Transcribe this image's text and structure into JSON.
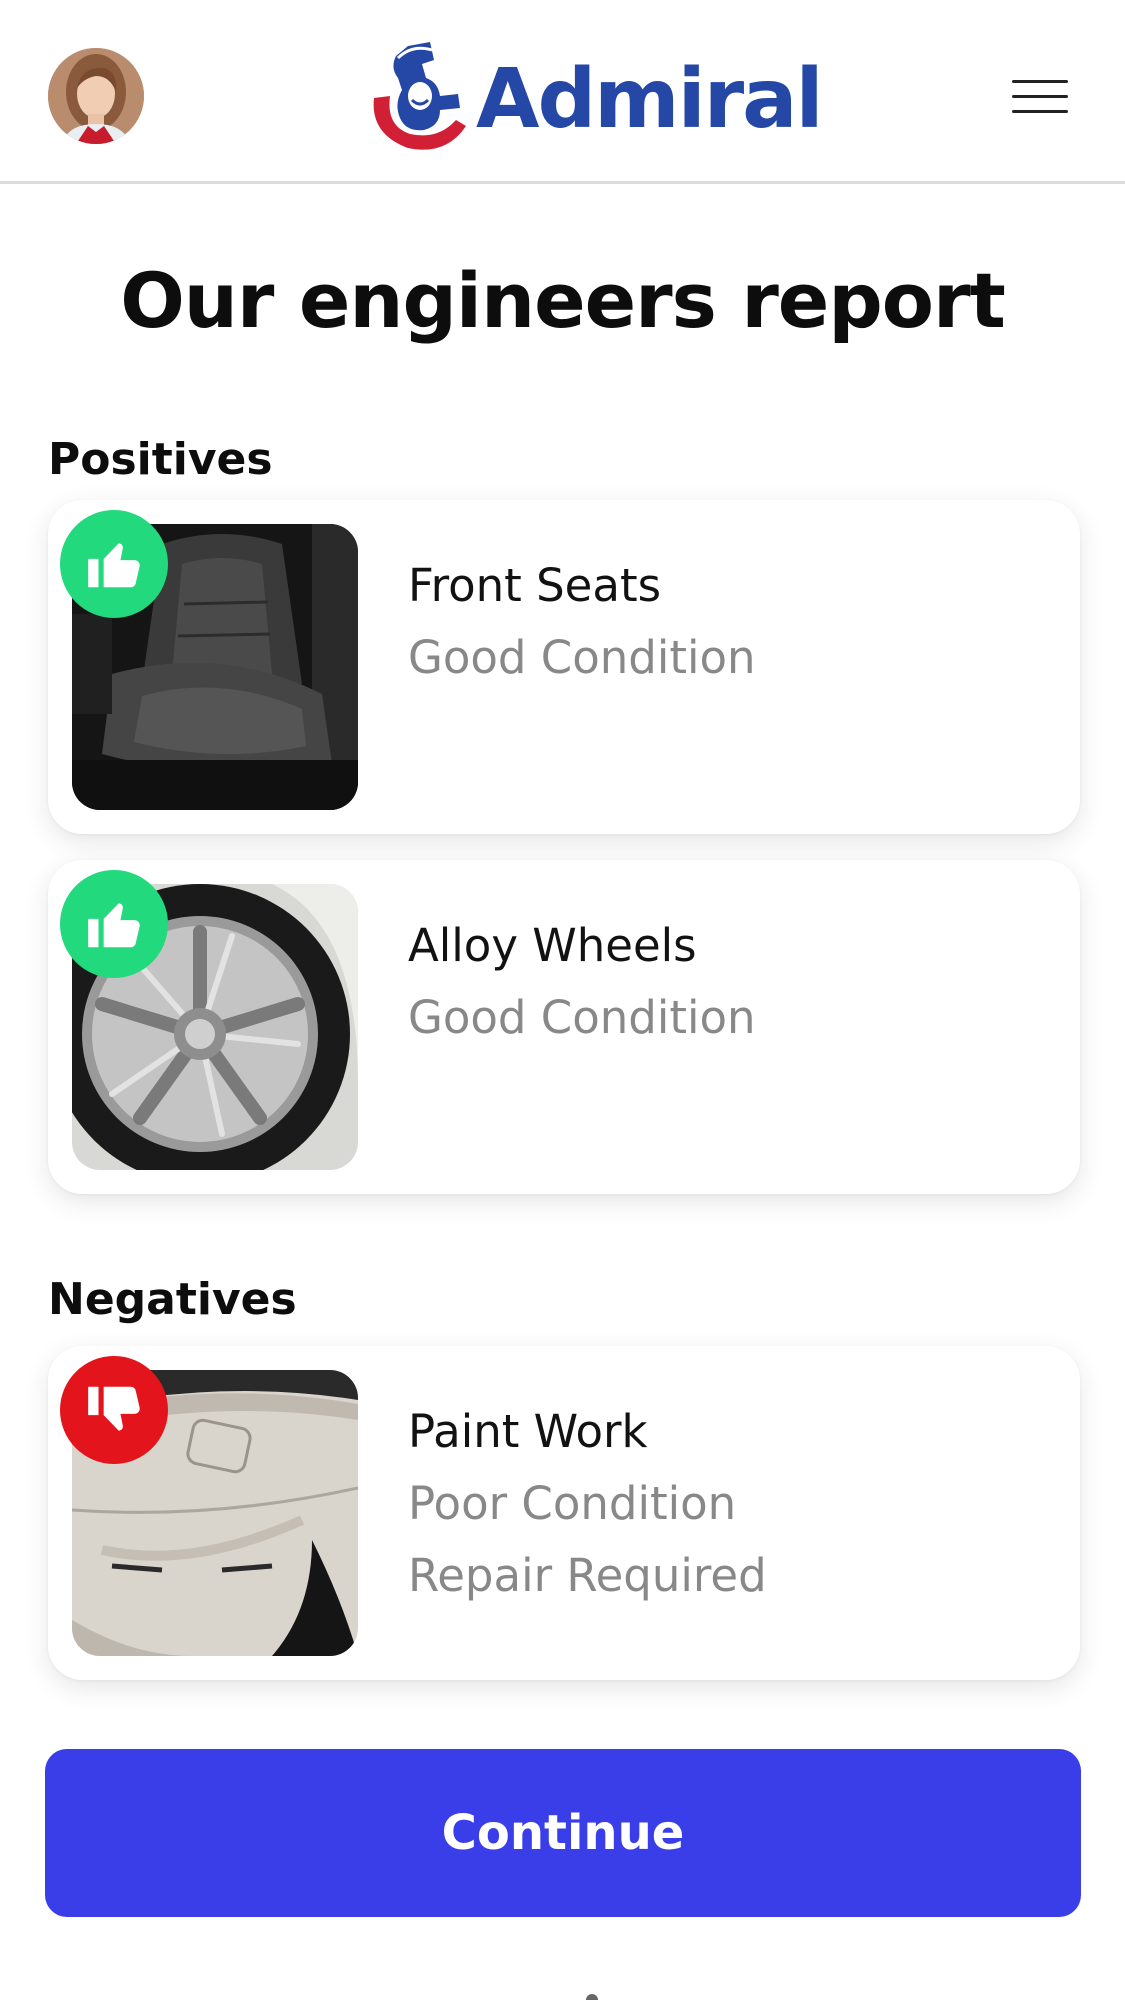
{
  "header": {
    "logo_text": "Admiral",
    "avatar_icon": "user-avatar",
    "menu_icon": "hamburger-menu-icon",
    "brand_color": "#2547a6"
  },
  "page_title": "Our engineers report",
  "positives": {
    "label": "Positives",
    "items": [
      {
        "title": "Front Seats",
        "status": "Good Condition",
        "icon": "thumbs-up-icon",
        "image": "car-seat-photo"
      },
      {
        "title": "Alloy Wheels",
        "status": "Good Condition",
        "icon": "thumbs-up-icon",
        "image": "alloy-wheel-photo"
      }
    ]
  },
  "negatives": {
    "label": "Negatives",
    "items": [
      {
        "title": "Paint Work",
        "status": "Poor Condition",
        "note": "Repair Required",
        "icon": "thumbs-down-icon",
        "image": "scratched-bumper-photo"
      }
    ]
  },
  "continue_label": "Continue",
  "colors": {
    "positive": "#22d97e",
    "negative": "#e4141c",
    "primary_button": "#3a3ee8",
    "muted_text": "#888888"
  }
}
